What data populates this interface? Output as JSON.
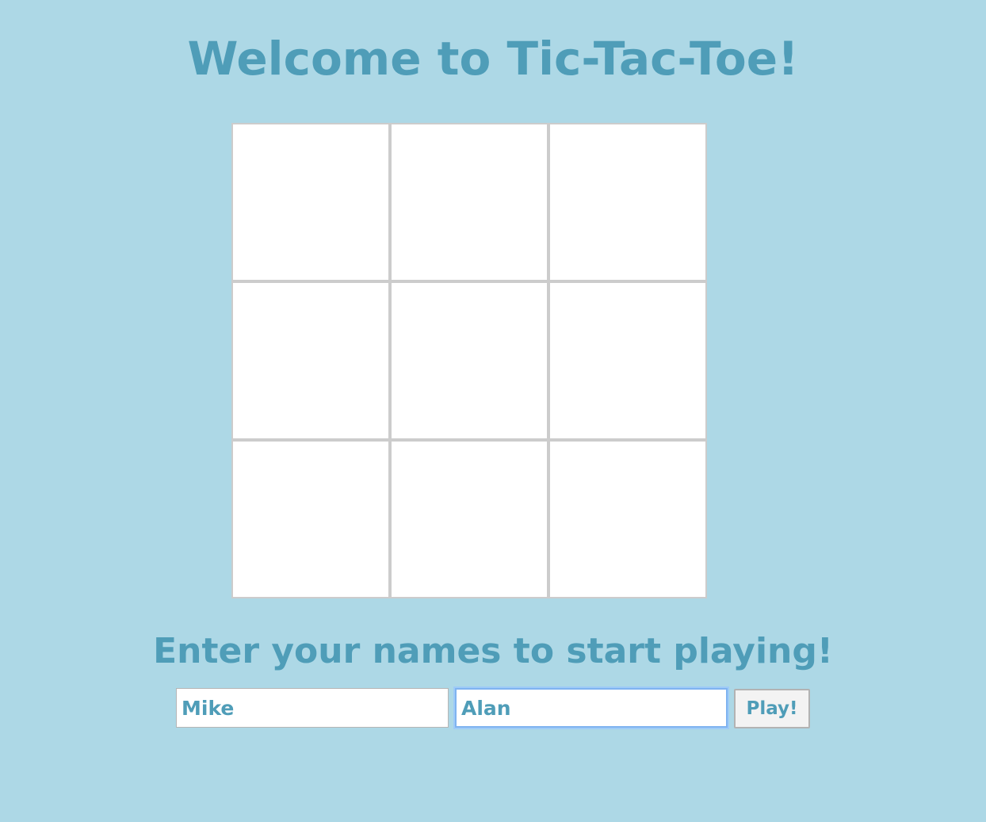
{
  "header": {
    "title": "Welcome to Tic-Tac-Toe!"
  },
  "board": {
    "cells": [
      "",
      "",
      "",
      "",
      "",
      "",
      "",
      "",
      ""
    ]
  },
  "setup": {
    "prompt": "Enter your names to start playing!",
    "player1_value": "Mike",
    "player2_value": "Alan",
    "play_label": "Play!"
  },
  "colors": {
    "background": "#add8e6",
    "accent_text": "#4f9db8",
    "cell_background": "#ffffff",
    "cell_border": "#cccccc"
  }
}
